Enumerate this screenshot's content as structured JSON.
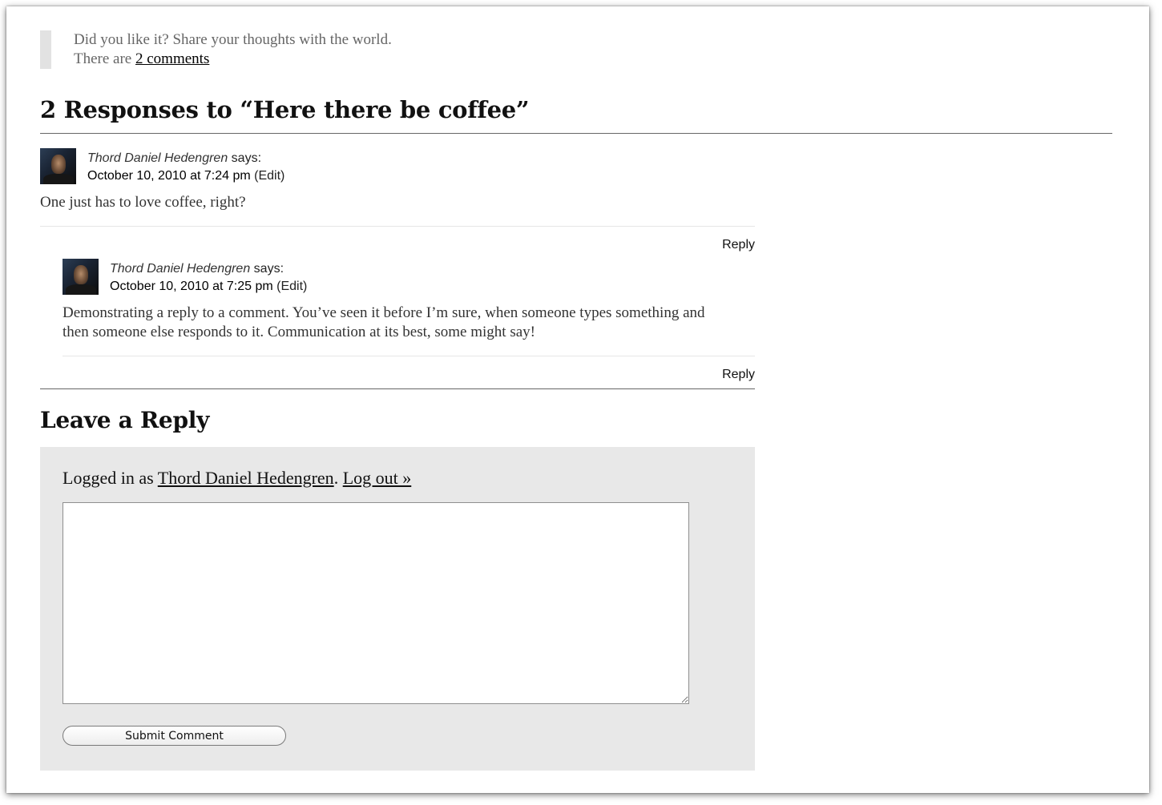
{
  "intro": {
    "line1": "Did you like it? Share your thoughts with the world.",
    "line2_prefix": "There are",
    "comments_link": "2 comments"
  },
  "responses_title": "2 Responses to “Here there be coffee”",
  "comments": [
    {
      "author": "Thord Daniel Hedengren",
      "says": "says:",
      "date": "October 10, 2010 at 7:24 pm",
      "edit": "(Edit)",
      "text": "One just has to love coffee, right?",
      "reply": "Reply"
    },
    {
      "author": "Thord Daniel Hedengren",
      "says": "says:",
      "date": "October 10, 2010 at 7:25 pm",
      "edit": "(Edit)",
      "text_line1": "Demonstrating a reply to a comment. You’ve seen it before I’m sure, when someone types something and",
      "text_line2": "then someone else responds to it. Communication at its best, some might say!",
      "reply": "Reply"
    }
  ],
  "reply_form": {
    "title": "Leave a Reply",
    "logged_in_prefix": "Logged in as",
    "user": "Thord Daniel Hedengren",
    "logout": "Log out »",
    "textarea_value": "",
    "submit_label": "Submit Comment"
  },
  "colors": {
    "form_background": "#e8e8e8",
    "callout_bar": "#e2e2e2"
  }
}
